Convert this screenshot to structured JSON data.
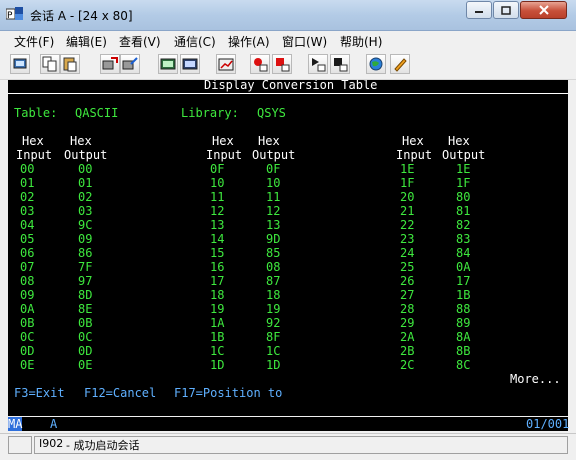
{
  "window": {
    "title": "会话 A - [24 x 80]"
  },
  "menu": [
    "文件(F)",
    "编辑(E)",
    "查看(V)",
    "通信(C)",
    "操作(A)",
    "窗口(W)",
    "帮助(H)"
  ],
  "toolbar": [
    "print-screen",
    "copy",
    "paste",
    "send",
    "receive",
    "display-keypad",
    "quick-keys",
    "record-macro",
    "play-macro",
    "stop-macro",
    "macro-list",
    "customize",
    "open-browser",
    "edit-keys"
  ],
  "screen": {
    "title": "Display Conversion Table",
    "table_label": "Table:",
    "table_value": "QASCII",
    "library_label": "Library:",
    "library_value": "QSYS",
    "col_header_top": [
      "Hex",
      "Hex"
    ],
    "col_header_bottom": [
      "Input",
      "Output"
    ],
    "columns": [
      [
        [
          "00",
          "00"
        ],
        [
          "01",
          "01"
        ],
        [
          "02",
          "02"
        ],
        [
          "03",
          "03"
        ],
        [
          "04",
          "9C"
        ],
        [
          "05",
          "09"
        ],
        [
          "06",
          "86"
        ],
        [
          "07",
          "7F"
        ],
        [
          "08",
          "97"
        ],
        [
          "09",
          "8D"
        ],
        [
          "0A",
          "8E"
        ],
        [
          "0B",
          "0B"
        ],
        [
          "0C",
          "0C"
        ],
        [
          "0D",
          "0D"
        ],
        [
          "0E",
          "0E"
        ]
      ],
      [
        [
          "0F",
          "0F"
        ],
        [
          "10",
          "10"
        ],
        [
          "11",
          "11"
        ],
        [
          "12",
          "12"
        ],
        [
          "13",
          "13"
        ],
        [
          "14",
          "9D"
        ],
        [
          "15",
          "85"
        ],
        [
          "16",
          "08"
        ],
        [
          "17",
          "87"
        ],
        [
          "18",
          "18"
        ],
        [
          "19",
          "19"
        ],
        [
          "1A",
          "92"
        ],
        [
          "1B",
          "8F"
        ],
        [
          "1C",
          "1C"
        ],
        [
          "1D",
          "1D"
        ]
      ],
      [
        [
          "1E",
          "1E"
        ],
        [
          "1F",
          "1F"
        ],
        [
          "20",
          "80"
        ],
        [
          "21",
          "81"
        ],
        [
          "22",
          "82"
        ],
        [
          "23",
          "83"
        ],
        [
          "24",
          "84"
        ],
        [
          "25",
          "0A"
        ],
        [
          "26",
          "17"
        ],
        [
          "27",
          "1B"
        ],
        [
          "28",
          "88"
        ],
        [
          "29",
          "89"
        ],
        [
          "2A",
          "8A"
        ],
        [
          "2B",
          "8B"
        ],
        [
          "2C",
          "8C"
        ]
      ]
    ],
    "more": "More...",
    "fkeys": [
      "F3=Exit",
      "F12=Cancel",
      "F17=Position to"
    ]
  },
  "oia": {
    "indicator": "MA",
    "session": "A",
    "cursor": "01/001"
  },
  "status": {
    "message_code": "I902",
    "message": " - 成功启动会话"
  }
}
